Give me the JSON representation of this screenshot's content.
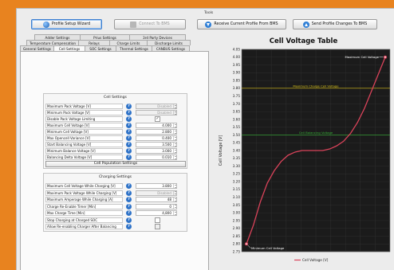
{
  "toolbar": {
    "label": "Tools",
    "wizard": "Profile Setup Wizard",
    "connect": "Connect To BMS",
    "receive": "Receive Current Profile From BMS",
    "send": "Send Profile Changes To BMS"
  },
  "tabs": {
    "row1": [
      "Adder Settings",
      "Prius Settings",
      "3rd Party Devices"
    ],
    "row2": [
      "Temperature Compensation",
      "Relays",
      "Charge Limits",
      "Discharge Limits"
    ],
    "row3": [
      "General Settings",
      "Cell Settings",
      "SOC Settings",
      "Thermal Settings",
      "CANBUS Settings"
    ],
    "active": "Cell Settings"
  },
  "cell_settings": {
    "title": "Cell Settings",
    "rows": [
      {
        "label": "Maximum Pack Voltage [V]",
        "value": "Disabled",
        "disabled": true,
        "kind": "spin"
      },
      {
        "label": "Minimum Pack Voltage [V]",
        "value": "Disabled",
        "disabled": true,
        "kind": "spin"
      },
      {
        "label": "Disable Pack Voltage Limiting",
        "value": "✓",
        "kind": "check"
      },
      {
        "label": "Maximum Cell Voltage [V]",
        "value": "4.000",
        "kind": "spin"
      },
      {
        "label": "Minimum Cell Voltage [V]",
        "value": "2.800",
        "kind": "spin"
      },
      {
        "label": "Max Opencell Variance [V]",
        "value": "0.400",
        "kind": "spin"
      },
      {
        "label": "Start Balancing Voltage [V]",
        "value": "3.500",
        "kind": "spin"
      },
      {
        "label": "Minimum Balance Voltage [V]",
        "value": "3.000",
        "kind": "spin"
      },
      {
        "label": "Balancing Delta Voltage [V]",
        "value": "0.010",
        "kind": "spin"
      }
    ],
    "button": "Cell Population Settings"
  },
  "charging_settings": {
    "title": "Charging Settings",
    "rows": [
      {
        "label": "Maximum Cell Voltage While Charging [V]",
        "value": "3.800",
        "kind": "spin"
      },
      {
        "label": "Maximum Pack Voltage While Charging [V]",
        "value": "Disabled",
        "disabled": true,
        "kind": "spin"
      },
      {
        "label": "Maximum Amperage While Charging [A]",
        "value": "48",
        "kind": "spin"
      },
      {
        "label": "Charge Re-Enable Timer [Min]",
        "value": "0",
        "kind": "spin"
      },
      {
        "label": "Max Charge Time [Min]",
        "value": "4,800",
        "kind": "spin"
      },
      {
        "label": "Stop Charging at Charged SOC",
        "value": "",
        "kind": "check"
      },
      {
        "label": "Allow Re-enabling Charger After Balancing",
        "value": "",
        "disabled": true,
        "kind": "check"
      }
    ]
  },
  "chart_data": {
    "type": "line",
    "title": "Cell Voltage Table",
    "ylabel": "Cell Voltage [V]",
    "ylim": [
      2.75,
      4.05
    ],
    "yticks": [
      "4.05",
      "4.00",
      "3.95",
      "3.90",
      "3.85",
      "3.80",
      "3.75",
      "3.70",
      "3.65",
      "3.60",
      "3.55",
      "3.50",
      "3.45",
      "3.40",
      "3.35",
      "3.30",
      "3.25",
      "3.20",
      "3.15",
      "3.10",
      "3.05",
      "3.00",
      "2.95",
      "2.90",
      "2.85",
      "2.80",
      "2.75"
    ],
    "xlim": [
      0,
      100
    ],
    "series": [
      {
        "name": "Cell Voltage [V]",
        "color": "#d9435a",
        "x": [
          0,
          5,
          10,
          15,
          20,
          25,
          30,
          35,
          40,
          45,
          50,
          55,
          60,
          65,
          70,
          75,
          80,
          85,
          90,
          95,
          100
        ],
        "y": [
          2.8,
          2.92,
          3.07,
          3.19,
          3.27,
          3.33,
          3.37,
          3.39,
          3.4,
          3.4,
          3.4,
          3.4,
          3.41,
          3.43,
          3.46,
          3.51,
          3.58,
          3.67,
          3.78,
          3.89,
          4.0
        ]
      }
    ],
    "reference_lines": [
      {
        "label": "Maximum Charge Cell Voltage",
        "value": 3.8,
        "color": "#d9c21a"
      },
      {
        "label": "Cell Balancing Voltage",
        "value": 3.5,
        "color": "#36b236"
      }
    ],
    "annotations": [
      {
        "label": "Maximum Cell Voltage",
        "x": 100,
        "y": 4.0
      },
      {
        "label": "Minimum Cell Voltage",
        "x": 0,
        "y": 2.8
      }
    ],
    "background": "#1b1b1b",
    "grid": true,
    "legend": "bottom"
  }
}
